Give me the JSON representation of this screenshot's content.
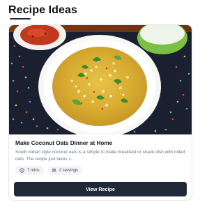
{
  "section": {
    "title": "Recipe Ideas"
  },
  "recipe": {
    "title": "Make Coconut Oats Dinner at Home",
    "description": "South Indian style coconut oats is a simple to make breakfast or snack dish with rolled oats. The recipe just takes 1...",
    "time": "7 mins",
    "servings": "2 servings",
    "button_label": "View Recipe",
    "image_icon": "food-photo"
  },
  "icons": {
    "time": "clock-icon",
    "servings": "users-icon"
  },
  "colors": {
    "button_bg": "#1f2937",
    "pill_bg": "#f3f4f6",
    "description": "#6b7280"
  }
}
